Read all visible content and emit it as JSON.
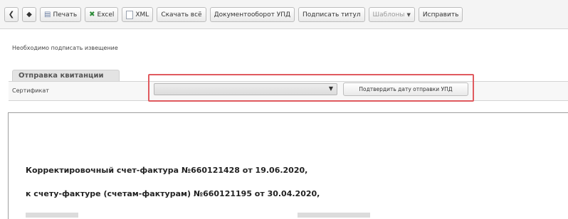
{
  "toolbar": {
    "print_label": "Печать",
    "excel_label": "Excel",
    "xml_label": "XML",
    "download_all_label": "Скачать всё",
    "workflow_label": "Документооборот УПД",
    "sign_title_label": "Подписать титул",
    "templates_label": "Шаблоны",
    "fix_label": "Исправить"
  },
  "notice": "Необходимо подписать извещение",
  "section": {
    "tab_label": "Отправка квитанции",
    "certificate_label": "Сертификат",
    "certificate_value": "",
    "confirm_button_label": "Подтвердить дату отправки УПД"
  },
  "document": {
    "line1": "Корректировочный счет-фактура №660121428 от 19.06.2020,",
    "line2": "к счету-фактуре (счетам-фактурам) №660121195 от 30.04.2020,"
  },
  "colors": {
    "highlight": "#e05a5f"
  }
}
